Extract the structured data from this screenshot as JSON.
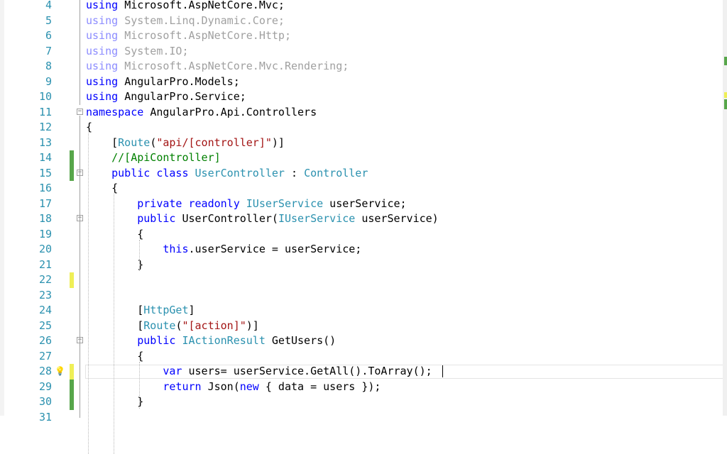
{
  "editor": {
    "lines": [
      {
        "n": "4",
        "marker": "",
        "fold": "",
        "segments": [
          {
            "t": "using ",
            "c": "kw"
          },
          {
            "t": "Microsoft.AspNetCore.Mvc;",
            "c": ""
          }
        ]
      },
      {
        "n": "5",
        "marker": "",
        "fold": "",
        "segments": [
          {
            "t": "using ",
            "c": "grkw"
          },
          {
            "t": "System.Linq.Dynamic.Core;",
            "c": "gr"
          }
        ]
      },
      {
        "n": "6",
        "marker": "",
        "fold": "",
        "segments": [
          {
            "t": "using ",
            "c": "grkw"
          },
          {
            "t": "Microsoft.AspNetCore.Http;",
            "c": "gr"
          }
        ]
      },
      {
        "n": "7",
        "marker": "",
        "fold": "",
        "segments": [
          {
            "t": "using ",
            "c": "grkw"
          },
          {
            "t": "System.IO;",
            "c": "gr"
          }
        ]
      },
      {
        "n": "8",
        "marker": "",
        "fold": "",
        "segments": [
          {
            "t": "using ",
            "c": "grkw"
          },
          {
            "t": "Microsoft.AspNetCore.Mvc.Rendering;",
            "c": "gr"
          }
        ]
      },
      {
        "n": "9",
        "marker": "",
        "fold": "",
        "segments": [
          {
            "t": "using ",
            "c": "kw"
          },
          {
            "t": "AngularPro.Models;",
            "c": ""
          }
        ]
      },
      {
        "n": "10",
        "marker": "",
        "fold": "",
        "segments": [
          {
            "t": "using ",
            "c": "kw"
          },
          {
            "t": "AngularPro.Service;",
            "c": ""
          }
        ]
      },
      {
        "n": "11",
        "marker": "",
        "fold": "minus",
        "segments": [
          {
            "t": "namespace ",
            "c": "kw"
          },
          {
            "t": "AngularPro.Api.Controllers",
            "c": ""
          }
        ]
      },
      {
        "n": "12",
        "marker": "",
        "fold": "",
        "segments": [
          {
            "t": "{",
            "c": ""
          }
        ]
      },
      {
        "n": "13",
        "marker": "",
        "fold": "",
        "segments": [
          {
            "t": "    [",
            "c": ""
          },
          {
            "t": "Route",
            "c": "ty"
          },
          {
            "t": "(",
            "c": ""
          },
          {
            "t": "\"api/[controller]\"",
            "c": "st"
          },
          {
            "t": ")]",
            "c": ""
          }
        ]
      },
      {
        "n": "14",
        "marker": "green",
        "fold": "",
        "segments": [
          {
            "t": "    ",
            "c": ""
          },
          {
            "t": "//[ApiController]",
            "c": "cm"
          }
        ]
      },
      {
        "n": "15",
        "marker": "green",
        "fold": "minus",
        "segments": [
          {
            "t": "    ",
            "c": ""
          },
          {
            "t": "public ",
            "c": "kw"
          },
          {
            "t": "class ",
            "c": "kw"
          },
          {
            "t": "UserController",
            "c": "ty"
          },
          {
            "t": " : ",
            "c": ""
          },
          {
            "t": "Controller",
            "c": "ty"
          }
        ]
      },
      {
        "n": "16",
        "marker": "",
        "fold": "",
        "segments": [
          {
            "t": "    {",
            "c": ""
          }
        ]
      },
      {
        "n": "17",
        "marker": "",
        "fold": "",
        "segments": [
          {
            "t": "        ",
            "c": ""
          },
          {
            "t": "private ",
            "c": "kw"
          },
          {
            "t": "readonly ",
            "c": "kw"
          },
          {
            "t": "IUserService",
            "c": "ty"
          },
          {
            "t": " userService;",
            "c": ""
          }
        ]
      },
      {
        "n": "18",
        "marker": "",
        "fold": "minus",
        "segments": [
          {
            "t": "        ",
            "c": ""
          },
          {
            "t": "public ",
            "c": "kw"
          },
          {
            "t": "UserController(",
            "c": ""
          },
          {
            "t": "IUserService",
            "c": "ty"
          },
          {
            "t": " userService)",
            "c": ""
          }
        ]
      },
      {
        "n": "19",
        "marker": "",
        "fold": "",
        "segments": [
          {
            "t": "        {",
            "c": ""
          }
        ]
      },
      {
        "n": "20",
        "marker": "",
        "fold": "",
        "segments": [
          {
            "t": "            ",
            "c": ""
          },
          {
            "t": "this",
            "c": "kw"
          },
          {
            "t": ".userService = userService;",
            "c": ""
          }
        ]
      },
      {
        "n": "21",
        "marker": "",
        "fold": "",
        "segments": [
          {
            "t": "        }",
            "c": ""
          }
        ]
      },
      {
        "n": "22",
        "marker": "yellow",
        "fold": "",
        "segments": [
          {
            "t": "",
            "c": ""
          }
        ]
      },
      {
        "n": "23",
        "marker": "",
        "fold": "",
        "segments": [
          {
            "t": "",
            "c": ""
          }
        ]
      },
      {
        "n": "24",
        "marker": "",
        "fold": "",
        "segments": [
          {
            "t": "        [",
            "c": ""
          },
          {
            "t": "HttpGet",
            "c": "ty"
          },
          {
            "t": "]",
            "c": ""
          }
        ]
      },
      {
        "n": "25",
        "marker": "",
        "fold": "",
        "segments": [
          {
            "t": "        [",
            "c": ""
          },
          {
            "t": "Route",
            "c": "ty"
          },
          {
            "t": "(",
            "c": ""
          },
          {
            "t": "\"[action]\"",
            "c": "st"
          },
          {
            "t": ")]",
            "c": ""
          }
        ]
      },
      {
        "n": "26",
        "marker": "",
        "fold": "minus",
        "segments": [
          {
            "t": "        ",
            "c": ""
          },
          {
            "t": "public ",
            "c": "kw"
          },
          {
            "t": "IActionResult",
            "c": "ty"
          },
          {
            "t": " GetUsers()",
            "c": ""
          }
        ]
      },
      {
        "n": "27",
        "marker": "",
        "fold": "",
        "segments": [
          {
            "t": "        {",
            "c": ""
          }
        ]
      },
      {
        "n": "28",
        "marker": "yellow",
        "fold": "",
        "bulb": true,
        "current": true,
        "segments": [
          {
            "t": "            ",
            "c": ""
          },
          {
            "t": "var ",
            "c": "kw"
          },
          {
            "t": "users= userService.GetAll().ToArray(); ",
            "c": ""
          }
        ]
      },
      {
        "n": "29",
        "marker": "green",
        "fold": "",
        "segments": [
          {
            "t": "            ",
            "c": ""
          },
          {
            "t": "return ",
            "c": "kw"
          },
          {
            "t": "Json(",
            "c": ""
          },
          {
            "t": "new ",
            "c": "kw"
          },
          {
            "t": "{ data = users });",
            "c": ""
          }
        ]
      },
      {
        "n": "30",
        "marker": "green",
        "fold": "",
        "segments": [
          {
            "t": "        }",
            "c": ""
          }
        ]
      },
      {
        "n": "31",
        "marker": "",
        "fold": "",
        "segments": [
          {
            "t": "",
            "c": ""
          }
        ]
      }
    ]
  },
  "icons": {
    "lightbulb": "lightbulb-icon",
    "fold": "collapse-icon"
  },
  "colors": {
    "keyword": "#0000ff",
    "type": "#2b91af",
    "string": "#a31515",
    "comment": "#008000",
    "changed_saved": "#57a64a",
    "changed_unsaved": "#efef57"
  }
}
